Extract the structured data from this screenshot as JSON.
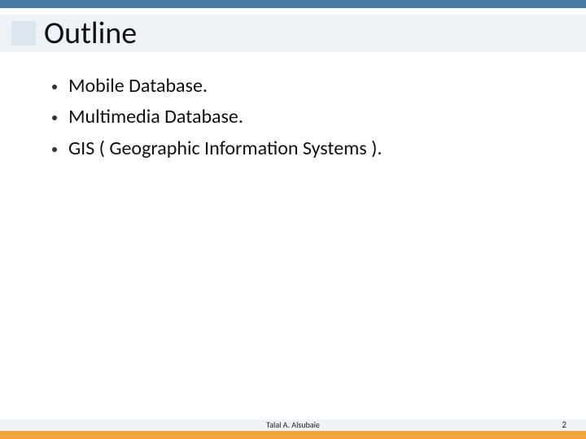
{
  "title": "Outline",
  "bullets": [
    "Mobile Database.",
    "Multimedia Database.",
    "GIS ( Geographic Information Systems )."
  ],
  "footer": {
    "author": "Talal A. Alsubaie",
    "page": "2"
  }
}
